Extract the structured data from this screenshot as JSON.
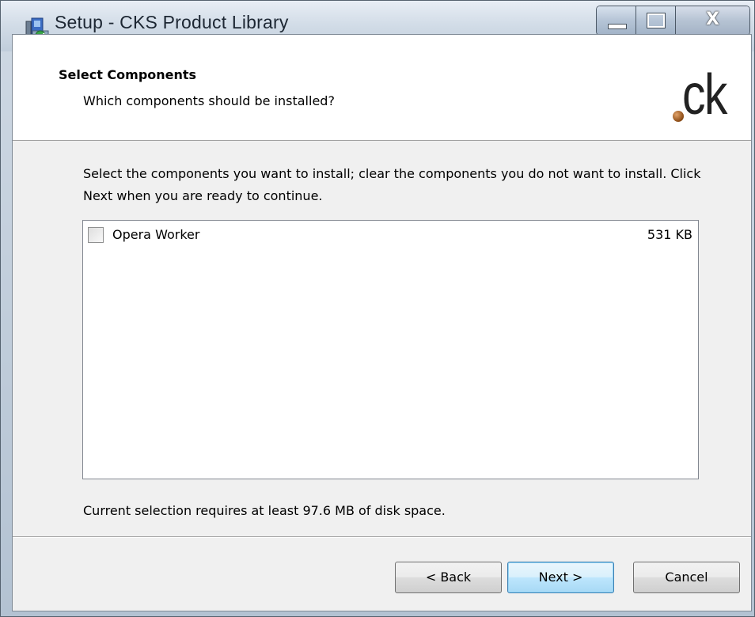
{
  "window": {
    "title": "Setup - CKS Product Library",
    "caption_buttons": {
      "minimize_icon": "minimize-icon",
      "maximize_icon": "maximize-icon",
      "close_label": "X"
    }
  },
  "header": {
    "title": "Select Components",
    "subtitle": "Which components should be installed?",
    "logo_text": "ck"
  },
  "instructions": "Select the components you want to install; clear the components you do not want to install. Click Next when you are ready to continue.",
  "components": [
    {
      "label": "Opera Worker",
      "size": "531 KB",
      "checked": false
    }
  ],
  "disk_space": "Current selection requires at least 97.6 MB of disk space.",
  "buttons": {
    "back": "< Back",
    "next": "Next >",
    "cancel": "Cancel"
  },
  "colors": {
    "default_button_border": "#3c7fb1",
    "logo_dot": "#a8642a"
  }
}
